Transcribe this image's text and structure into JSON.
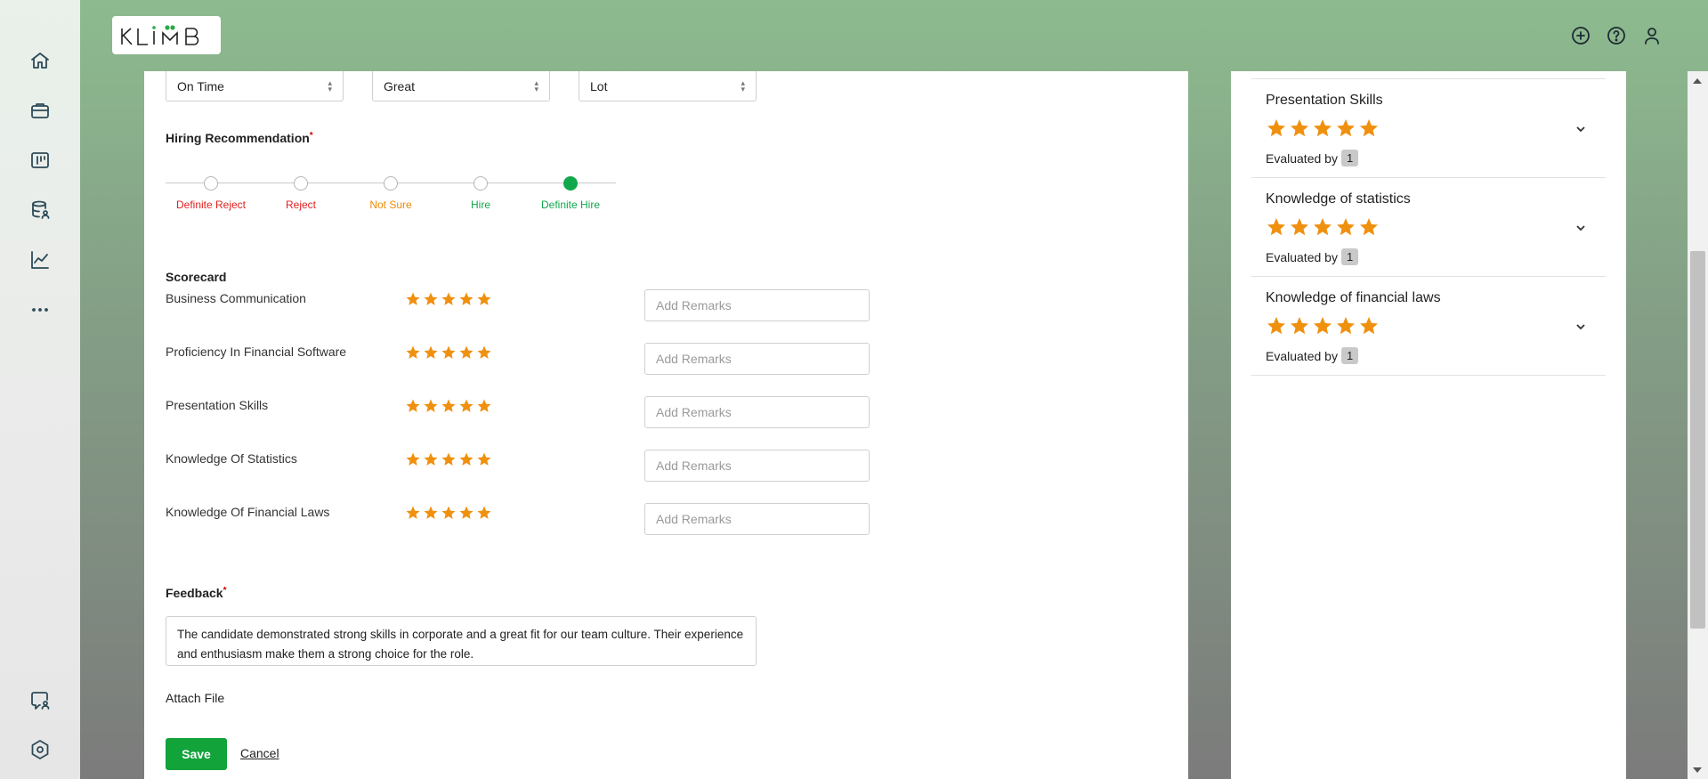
{
  "logo": {
    "text": "KLIMB"
  },
  "form": {
    "selects": [
      {
        "value": "On Time"
      },
      {
        "value": "Great"
      },
      {
        "value": "Lot"
      }
    ],
    "hiring_recommendation": {
      "label": "Hiring Recommendation",
      "required_mark": "*",
      "selected": "Definite Hire",
      "options": [
        {
          "label": "Definite Reject",
          "color": "#e02020"
        },
        {
          "label": "Reject",
          "color": "#e02020"
        },
        {
          "label": "Not Sure",
          "color": "#f08a00"
        },
        {
          "label": "Hire",
          "color": "#10a84a"
        },
        {
          "label": "Definite Hire",
          "color": "#10a84a"
        }
      ]
    },
    "scorecard": {
      "title": "Scorecard",
      "remarks_placeholder": "Add Remarks",
      "items": [
        {
          "label": "Business Communication",
          "rating": 5,
          "max": 5
        },
        {
          "label": "Proficiency In Financial Software",
          "rating": 5,
          "max": 5
        },
        {
          "label": "Presentation Skills",
          "rating": 5,
          "max": 5
        },
        {
          "label": "Knowledge Of Statistics",
          "rating": 5,
          "max": 5
        },
        {
          "label": "Knowledge Of Financial Laws",
          "rating": 5,
          "max": 5
        }
      ]
    },
    "feedback": {
      "label": "Feedback",
      "required_mark": "*",
      "text": "The candidate demonstrated strong skills in corporate and a great fit for our team culture. Their experience and enthusiasm make them a strong choice for the role."
    },
    "attach_label": "Attach File",
    "save_label": "Save",
    "cancel_label": "Cancel"
  },
  "summary": {
    "items": [
      {
        "title": "Presentation Skills",
        "rating": 5,
        "evaluated_label": "Evaluated by",
        "evaluated_count": "1"
      },
      {
        "title": "Knowledge of statistics",
        "rating": 5,
        "evaluated_label": "Evaluated by",
        "evaluated_count": "1"
      },
      {
        "title": "Knowledge of financial laws",
        "rating": 5,
        "evaluated_label": "Evaluated by",
        "evaluated_count": "1"
      }
    ]
  },
  "colors": {
    "accent_green": "#12a33b",
    "star": "#f0900f"
  },
  "icons": {
    "sidebar": [
      "home-icon",
      "briefcase-icon",
      "board-icon",
      "database-user-icon",
      "analytics-icon",
      "more-icon",
      "chat-user-icon",
      "settings-icon"
    ],
    "header": [
      "add-circle-icon",
      "help-icon",
      "user-icon"
    ]
  }
}
